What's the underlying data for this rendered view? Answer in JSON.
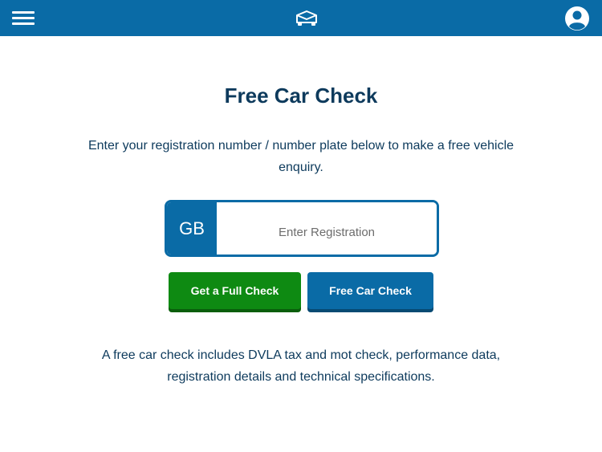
{
  "header": {
    "menu_icon": "hamburger-menu-icon",
    "logo_icon": "car-envelope-logo-icon",
    "account_icon": "user-account-icon",
    "bar_color": "#0a6ba6"
  },
  "main": {
    "title": "Free Car Check",
    "intro": "Enter your registration number / number plate below to make a free vehicle enquiry.",
    "registration": {
      "country_code": "GB",
      "placeholder": "Enter Registration",
      "value": ""
    },
    "buttons": {
      "full_check": "Get a Full Check",
      "free_check": "Free Car Check"
    },
    "footer_text": "A free car check includes DVLA tax and mot check, performance data, registration details and technical specifications."
  },
  "colors": {
    "brand_blue": "#0a6ba6",
    "green_button": "#0e8a12",
    "text_dark": "#0d3a5c"
  }
}
